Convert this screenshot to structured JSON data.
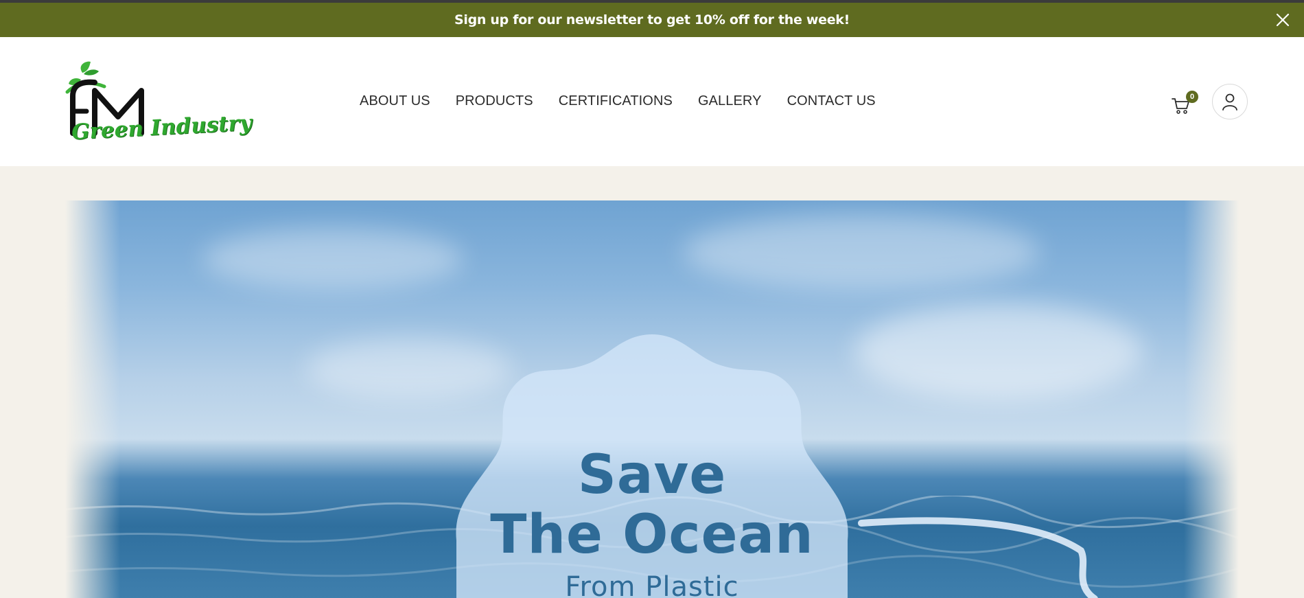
{
  "announcement": {
    "text": "Sign up for our newsletter to get 10% off for the week!",
    "close_icon": "close-icon"
  },
  "brand": {
    "logo_letters": "FM",
    "logo_word": "Green Industry"
  },
  "nav": {
    "items": [
      {
        "label": "ABOUT US"
      },
      {
        "label": "PRODUCTS"
      },
      {
        "label": "CERTIFICATIONS"
      },
      {
        "label": "GALLERY"
      },
      {
        "label": "CONTACT US"
      }
    ]
  },
  "cart": {
    "count": "0",
    "icon": "cart-icon"
  },
  "account": {
    "icon": "user-icon"
  },
  "hero": {
    "line1": "Save",
    "line2": "The Ocean",
    "line3": "From Plastic"
  },
  "colors": {
    "announce_bg": "#5f6b20",
    "page_bg": "#f4f1ea",
    "hero_text": "#2f6b97",
    "logo_green": "#2fa82f"
  }
}
